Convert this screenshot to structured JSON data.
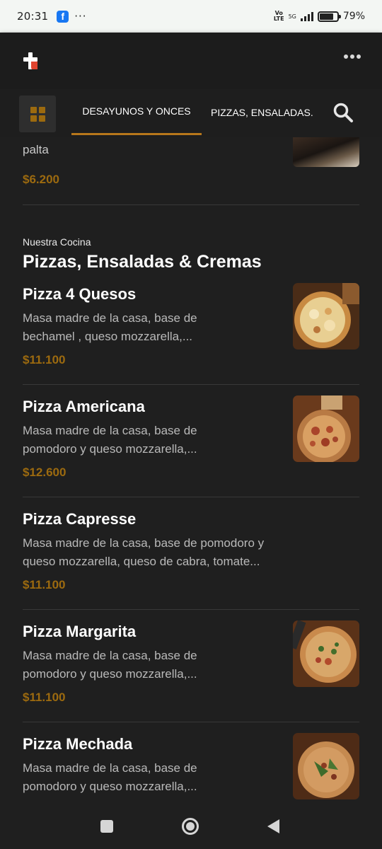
{
  "status_bar": {
    "time": "20:31",
    "dots": "···",
    "volte_top": "Vo",
    "volte_bottom": "LTE",
    "network": "5G",
    "battery": "79%",
    "battery_level": 0.79
  },
  "header": {
    "logo_icon": "brand-cross-icon",
    "more_icon": "more-dots-icon"
  },
  "tabs": {
    "grid_icon": "grid-icon",
    "items": [
      {
        "label": "DESAYUNOS Y ONCES",
        "active": true
      },
      {
        "label": "PIZZAS, ENSALADAS."
      }
    ],
    "search_icon": "search-icon"
  },
  "partial_item": {
    "desc": "palta",
    "price": "$6.200"
  },
  "section": {
    "kicker": "Nuestra Cocina",
    "title": "Pizzas, Ensaladas & Cremas"
  },
  "items": [
    {
      "name": "Pizza 4 Quesos",
      "desc": "Masa madre de la casa, base de bechamel , queso mozzarella,...",
      "price": "$11.100"
    },
    {
      "name": "Pizza Americana",
      "desc": "Masa madre de la casa, base de pomodoro y queso mozzarella,...",
      "price": "$12.600"
    },
    {
      "name": "Pizza Capresse",
      "desc": "Masa madre de la casa, base de pomodoro y queso mozzarella, queso de cabra, tomate...",
      "price": "$11.100"
    },
    {
      "name": "Pizza Margarita",
      "desc": "Masa madre de la casa, base de pomodoro y queso mozzarella,...",
      "price": "$11.100"
    },
    {
      "name": "Pizza Mechada",
      "desc": "Masa madre de la casa, base de pomodoro y queso mozzarella,...",
      "price": ""
    }
  ],
  "colors": {
    "background": "#1f1f1f",
    "accent": "#b7771b",
    "price": "#9c6a0f"
  },
  "nav": {
    "recents_icon": "square-icon",
    "home_icon": "circle-icon",
    "back_icon": "triangle-back-icon"
  }
}
